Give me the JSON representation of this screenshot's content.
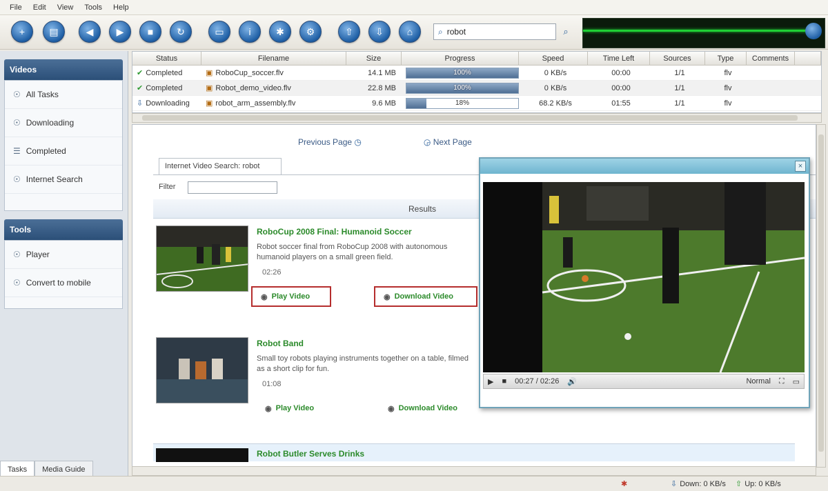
{
  "menu": [
    "File",
    "Edit",
    "View",
    "Tools",
    "Help"
  ],
  "toolbar": {
    "buttons": [
      {
        "name": "add-url-button",
        "glyph": "+"
      },
      {
        "name": "open-button",
        "glyph": "▤"
      },
      {
        "name": "back-button",
        "glyph": "◀"
      },
      {
        "name": "forward-button",
        "glyph": "▶"
      },
      {
        "name": "stop-button",
        "glyph": "■"
      },
      {
        "name": "refresh-button",
        "glyph": "↻"
      },
      {
        "name": "folder-button",
        "glyph": "▭"
      },
      {
        "name": "info-button",
        "glyph": "i"
      },
      {
        "name": "tools-button",
        "glyph": "✱"
      },
      {
        "name": "settings-button",
        "glyph": "⚙"
      },
      {
        "name": "upload-button",
        "glyph": "⇧"
      },
      {
        "name": "download-button",
        "glyph": "⇩"
      },
      {
        "name": "home-button",
        "glyph": "⌂"
      }
    ],
    "search_value": "robot",
    "search_go": "⌕"
  },
  "sidebar": {
    "panel1_title": "Videos",
    "panel1_items": [
      {
        "label": "All Tasks",
        "icon": "☉"
      },
      {
        "label": "Downloading",
        "icon": "☉"
      },
      {
        "label": "Completed",
        "icon": "☰"
      },
      {
        "label": "Internet Search",
        "icon": "☉"
      }
    ],
    "panel2_title": "Tools",
    "panel2_items": [
      {
        "label": "Player",
        "icon": "☉"
      },
      {
        "label": "Convert to mobile",
        "icon": "☉"
      }
    ],
    "tabs": [
      "Tasks",
      "Media Guide"
    ]
  },
  "downloads": {
    "columns": [
      "Status",
      "Filename",
      "Size",
      "Progress",
      "Speed",
      "Time Left",
      "Sources",
      "Type",
      "Comments",
      ""
    ],
    "rows": [
      {
        "status": "Completed",
        "filename": "RoboCup_soccer.flv",
        "size": "14.1 MB",
        "progress": 1.0,
        "progress_label": "100%",
        "speed": "0 KB/s",
        "time_left": "00:00",
        "sources": "1/1",
        "type": "flv",
        "comment": ""
      },
      {
        "status": "Completed",
        "filename": "Robot_demo_video.flv",
        "size": "22.8 MB",
        "progress": 1.0,
        "progress_label": "100%",
        "speed": "0 KB/s",
        "time_left": "00:00",
        "sources": "1/1",
        "type": "flv",
        "comment": ""
      },
      {
        "status": "Downloading",
        "filename": "robot_arm_assembly.flv",
        "size": "9.6 MB",
        "progress": 0.18,
        "progress_label": "18%",
        "speed": "68.2 KB/s",
        "time_left": "01:55",
        "sources": "1/1",
        "type": "flv",
        "comment": ""
      }
    ]
  },
  "browser": {
    "nav_links": [
      "Previous Page",
      "Next Page"
    ],
    "page_tab": "Internet Video Search: robot",
    "filter_label": "Filter",
    "results_bar": "Results",
    "results": [
      {
        "title": "RoboCup 2008 Final: Humanoid Soccer",
        "desc": "Robot soccer final from RoboCup 2008 with autonomous humanoid players on a small green field.",
        "duration": "02:26",
        "btn1": "Play Video",
        "btn2": "Download Video"
      },
      {
        "title": "Robot Band",
        "desc": "Small toy robots playing instruments together on a table, filmed as a short clip for fun.",
        "duration": "01:08",
        "btn1": "Play Video",
        "btn2": "Download Video"
      },
      {
        "title": "Robot Butler Serves Drinks",
        "desc": "",
        "duration": "",
        "btn1": "",
        "btn2": ""
      }
    ]
  },
  "player": {
    "close_glyph": "×",
    "time": "00:27 / 02:26",
    "quality": "Normal",
    "controls": [
      "▶",
      "■",
      "🔊"
    ]
  },
  "statusbar": {
    "down": "Down: 0 KB/s",
    "up": "Up: 0 KB/s"
  }
}
